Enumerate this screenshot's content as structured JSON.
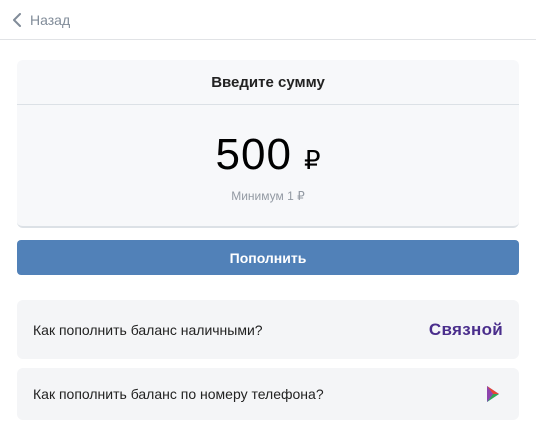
{
  "header": {
    "back_label": "Назад"
  },
  "amount_card": {
    "title": "Введите сумму",
    "amount": "500",
    "currency": "₽",
    "minimum": "Минимум 1 ₽"
  },
  "actions": {
    "topup_label": "Пополнить"
  },
  "info": {
    "cash": {
      "text": "Как пополнить баланс наличными?",
      "brand": "Связной"
    },
    "phone": {
      "text": "Как пополнить баланс по номеру телефона?"
    }
  },
  "colors": {
    "primary_button": "#5181b8",
    "brand_svyaznoy": "#4a2e8c"
  }
}
